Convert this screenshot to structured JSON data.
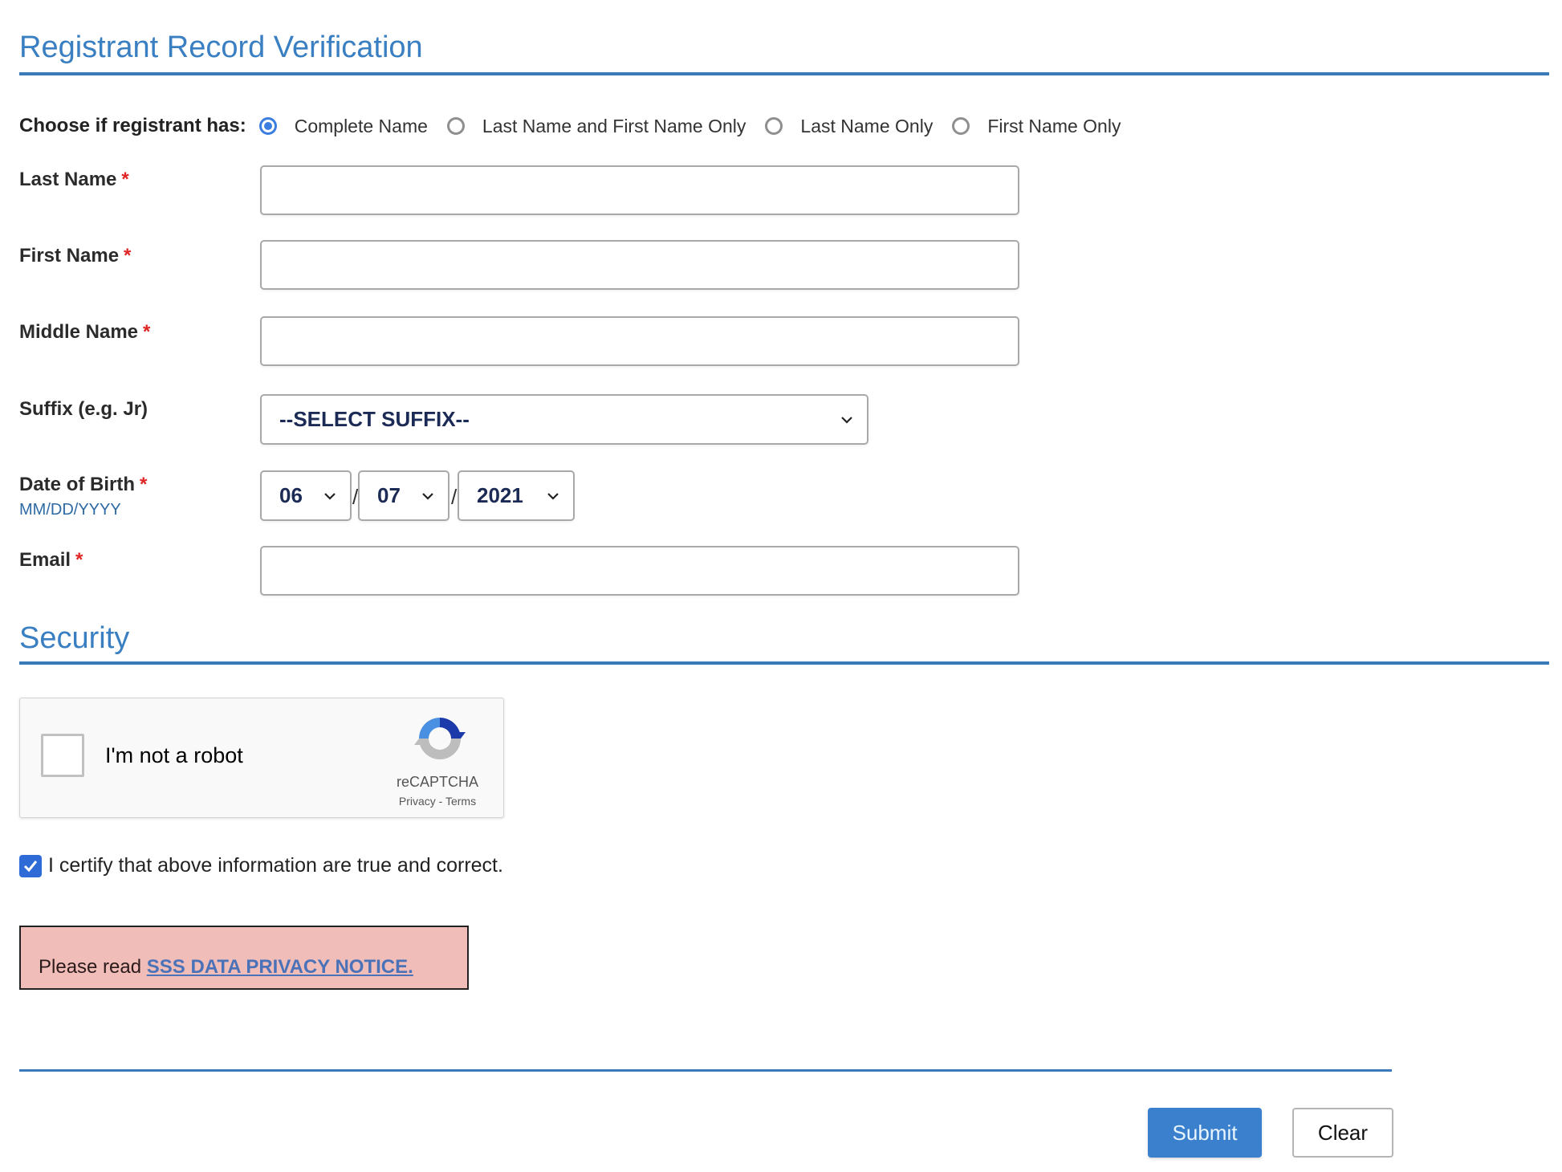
{
  "header": {
    "title": "Registrant Record Verification"
  },
  "name_option": {
    "label": "Choose if registrant has:",
    "options": [
      {
        "label": "Complete Name",
        "checked": true
      },
      {
        "label": "Last Name and First Name Only",
        "checked": false
      },
      {
        "label": "Last Name Only",
        "checked": false
      },
      {
        "label": "First Name Only",
        "checked": false
      }
    ]
  },
  "fields": {
    "last_name": {
      "label": "Last Name",
      "required_mark": "*",
      "value": ""
    },
    "first_name": {
      "label": "First Name",
      "required_mark": "*",
      "value": ""
    },
    "middle_name": {
      "label": "Middle Name",
      "required_mark": "*",
      "value": ""
    },
    "suffix": {
      "label": "Suffix (e.g. Jr)",
      "selected": "--SELECT SUFFIX--"
    },
    "dob": {
      "label": "Date of Birth",
      "required_mark": "*",
      "hint": "MM/DD/YYYY",
      "month": "06",
      "day": "07",
      "year": "2021",
      "separator": "/"
    },
    "email": {
      "label": "Email",
      "required_mark": "*",
      "value": ""
    }
  },
  "security": {
    "title": "Security",
    "captcha": {
      "label": "I'm not a robot",
      "brand": "reCAPTCHA",
      "privacy": "Privacy",
      "sep": "-",
      "terms": "Terms",
      "checked": false
    },
    "certify": {
      "label": "I certify that above information are true and correct.",
      "checked": true
    }
  },
  "notice": {
    "prefix": "Please read ",
    "link": "SSS DATA PRIVACY NOTICE."
  },
  "actions": {
    "submit": "Submit",
    "clear": "Clear"
  },
  "colors": {
    "accent": "#3a7fc1",
    "required": "#e02424",
    "notice_bg": "#f1bdb8",
    "submit_bg": "#3b80cc"
  }
}
